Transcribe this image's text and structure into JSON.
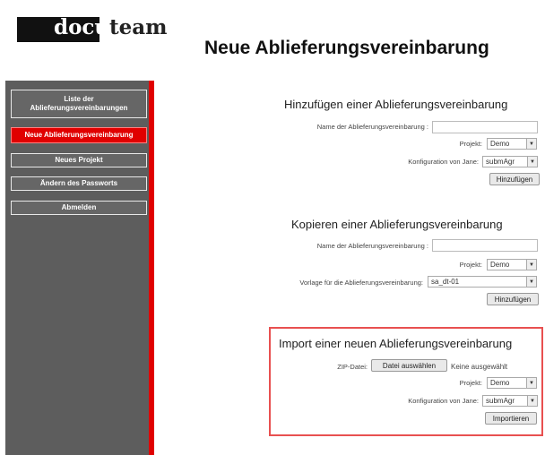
{
  "logo": {
    "part1": "docu",
    "part2": "team"
  },
  "page_title": "Neue Ablieferungsvereinbarung",
  "sidebar": {
    "items": [
      {
        "label": "Liste der Ablieferungsvereinbarungen"
      },
      {
        "label": "Neue Ablieferungsvereinbarung",
        "active": true
      },
      {
        "label": "Neues Projekt"
      },
      {
        "label": "Ändern des Passworts"
      },
      {
        "label": "Abmelden"
      }
    ]
  },
  "add_section": {
    "title": "Hinzufügen einer Ablieferungsvereinbarung",
    "name_label": "Name der Ablieferungsvereinbarung :",
    "name_value": "",
    "project_label": "Projekt:",
    "project_value": "Demo",
    "config_label": "Konfiguration von Jane:",
    "config_value": "submAgr",
    "submit_label": "Hinzufügen"
  },
  "copy_section": {
    "title": "Kopieren einer Ablieferungsvereinbarung",
    "name_label": "Name der Ablieferungsvereinbarung :",
    "name_value": "",
    "project_label": "Projekt:",
    "project_value": "Demo",
    "template_label": "Vorlage für die Ablieferungsvereinbarung:",
    "template_value": "sa_dt-01",
    "submit_label": "Hinzufügen"
  },
  "import_section": {
    "title": "Import einer neuen Ablieferungsvereinbarung",
    "zip_label": "ZIP-Datei:",
    "file_button_label": "Datei auswählen",
    "file_status": "Keine ausgewählt",
    "project_label": "Projekt:",
    "project_value": "Demo",
    "config_label": "Konfiguration von Jane:",
    "config_value": "submAgr",
    "submit_label": "Importieren"
  },
  "colors": {
    "accent_red": "#e00000",
    "sidebar_gray": "#5d5d5d",
    "highlight_box": "#e85050"
  }
}
